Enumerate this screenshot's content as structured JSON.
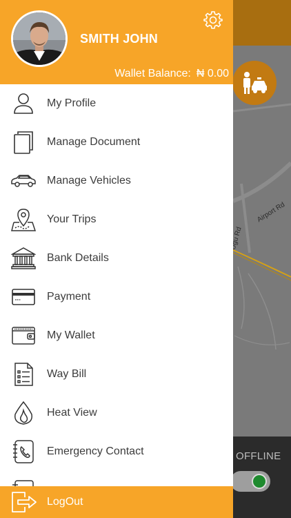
{
  "profile": {
    "name": "SMITH JOHN",
    "wallet_label": "Wallet Balance:",
    "wallet_value": "₦ 0.00"
  },
  "menu": {
    "items": [
      {
        "label": "My Profile",
        "icon": "user-icon"
      },
      {
        "label": "Manage Document",
        "icon": "documents-icon"
      },
      {
        "label": "Manage Vehicles",
        "icon": "car-icon"
      },
      {
        "label": "Your Trips",
        "icon": "map-pin-icon"
      },
      {
        "label": "Bank Details",
        "icon": "bank-icon"
      },
      {
        "label": "Payment",
        "icon": "credit-card-icon"
      },
      {
        "label": "My Wallet",
        "icon": "wallet-icon"
      },
      {
        "label": "Way Bill",
        "icon": "list-document-icon"
      },
      {
        "label": "Heat View",
        "icon": "flame-icon"
      },
      {
        "label": "Emergency Contact",
        "icon": "phone-book-icon"
      },
      {
        "label": "",
        "icon": "partial-item-icon"
      }
    ]
  },
  "logout": {
    "label": "LogOut"
  },
  "background": {
    "map_labels": {
      "airport": "Airport Rd",
      "ugu": "Ugu Rd"
    },
    "status_label": "OFFLINE"
  },
  "colors": {
    "accent": "#f7a528",
    "header_dark": "#a86e10",
    "online_knob": "#1e8a2e"
  }
}
